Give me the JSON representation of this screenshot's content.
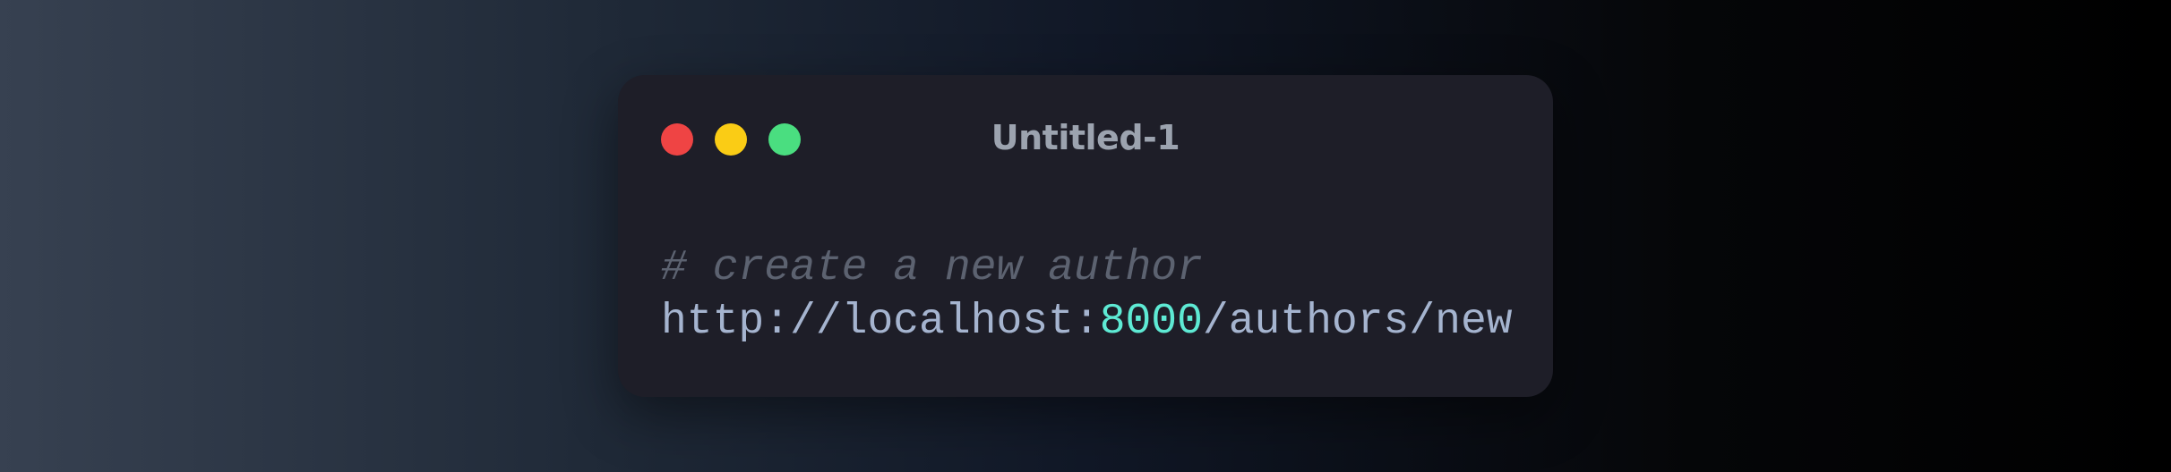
{
  "window": {
    "title": "Untitled-1",
    "traffic_lights": {
      "close_color": "#ef4444",
      "minimize_color": "#facc15",
      "maximize_color": "#4ade80"
    }
  },
  "code": {
    "comment": "# create a new author",
    "url": {
      "scheme": "http:",
      "slashes": "//",
      "host": "localhost:",
      "port": "8000",
      "path": "/authors/new"
    }
  },
  "colors": {
    "background_start": "#374151",
    "background_end": "#000000",
    "window_bg": "#1e1e28",
    "comment": "#5c6270",
    "text": "#a5b4cf",
    "port": "#5eead4"
  }
}
